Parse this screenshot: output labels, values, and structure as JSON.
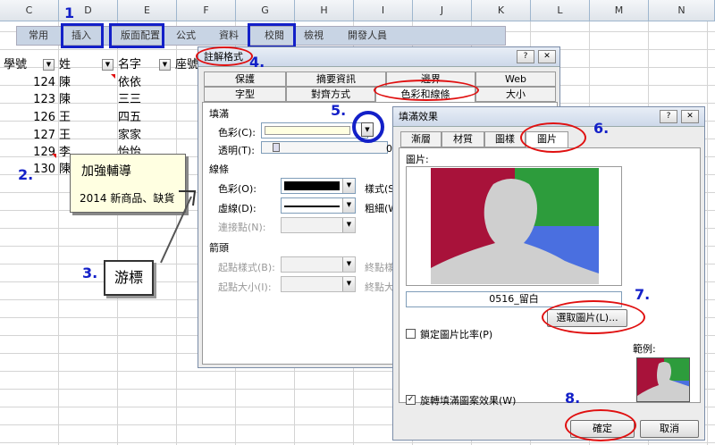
{
  "spreadsheet": {
    "columns": [
      "C",
      "D",
      "E",
      "F",
      "G",
      "H",
      "I",
      "J",
      "K",
      "L",
      "M",
      "N"
    ],
    "headers": {
      "c": "學號",
      "d": "姓",
      "e": "名字",
      "f": "座號"
    },
    "rows": [
      {
        "num": "124",
        "last": "陳",
        "first": "依依"
      },
      {
        "num": "123",
        "last": "陳",
        "first": "三三"
      },
      {
        "num": "126",
        "last": "王",
        "first": "四五"
      },
      {
        "num": "127",
        "last": "王",
        "first": "家家"
      },
      {
        "num": "129",
        "last": "李",
        "first": "怡怡"
      },
      {
        "num": "130",
        "last": "陳",
        "first": ""
      }
    ],
    "comment": {
      "title": "加強輔導",
      "body": "2014 新商品、缺貨"
    },
    "cursor_label": "游標"
  },
  "ribbon": {
    "tabs": [
      "常用",
      "插入",
      "版面配置",
      "公式",
      "資料",
      "校閱",
      "檢視",
      "開發人員"
    ]
  },
  "steps": [
    "1",
    "2.",
    "3.",
    "4.",
    "5.",
    "6.",
    "7.",
    "8."
  ],
  "format_dialog": {
    "title": "註解格式",
    "tabs_top": [
      "保護",
      "摘要資訊",
      "邊界",
      "Web"
    ],
    "tabs_bottom": [
      "字型",
      "對齊方式",
      "色彩和線條",
      "大小"
    ],
    "fill_section": "填滿",
    "color_label": "色彩(C):",
    "transparency_label": "透明(T):",
    "line_section": "線條",
    "line_color_label": "色彩(O):",
    "dash_label": "虛線(D):",
    "connector_label": "連接點(N):",
    "style_label": "樣式(S)",
    "weight_label": "粗細(W)",
    "arrow_section": "箭頭",
    "begin_style_label": "起點樣式(B):",
    "begin_size_label": "起點大小(I):",
    "end_style_label": "終點樣",
    "end_size_label": "終點大",
    "trans_value": "0",
    "fill_color": "#ffffe1"
  },
  "fill_dialog": {
    "title": "填滿效果",
    "tabs": [
      "漸層",
      "材質",
      "圖樣",
      "圖片"
    ],
    "picture_label": "圖片:",
    "file_name": "0516_留白",
    "select_button": "選取圖片(L)...",
    "lock_ratio_label": "鎖定圖片比率(P)",
    "rotate_label": "旋轉填滿圖案效果(W)",
    "rotate_checked": true,
    "sample_label": "範例:",
    "ok_button": "確定",
    "cancel_button": "取消"
  },
  "colors": {
    "step_blue": "#1320c8",
    "annotation_red": "#e01010",
    "img_red": "#a8123a",
    "img_green": "#2d9c3c",
    "img_blue": "#4a6fe0"
  }
}
